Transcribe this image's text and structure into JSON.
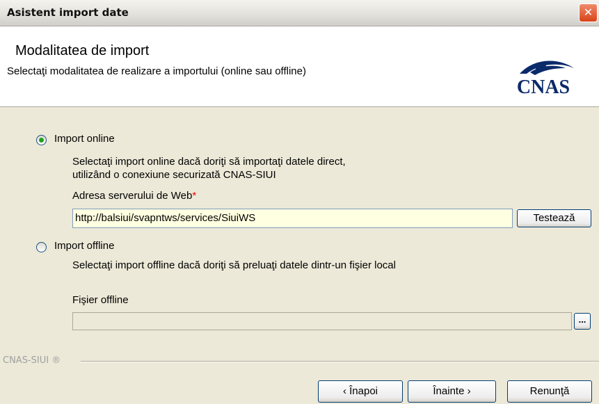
{
  "window": {
    "title": "Asistent import date",
    "close_glyph": "✕"
  },
  "header": {
    "title": "Modalitatea de import",
    "subtitle": "Selectaţi modalitatea de realizare a importului (online sau offline)",
    "logo_text": "CNAS"
  },
  "online": {
    "label": "Import online",
    "selected": true,
    "description_line1": "Selectaţi import online dacă doriţi să importaţi datele direct,",
    "description_line2": " utilizând o conexiune securizată CNAS-SIUI",
    "server_label": "Adresa serverului de Web",
    "required_mark": "*",
    "server_value": "http://balsiui/svapntws/services/SiuiWS",
    "test_button": "Testează"
  },
  "offline": {
    "label": "Import offline",
    "selected": false,
    "description": "Selectaţi import offline dacă doriţi să preluaţi datele dintr-un fişier local",
    "file_label": "Fişier offline",
    "file_value": "",
    "browse_button": "..."
  },
  "footer": {
    "brand": "CNAS-SIUI ®",
    "back_button": "‹ Înapoi",
    "next_button": "Înainte ›",
    "cancel_button": "Renunţă"
  },
  "colors": {
    "window_bg": "#ece9d8",
    "field_highlight": "#ffffe1",
    "required": "#ee0000",
    "radio_dot": "#21a121"
  }
}
